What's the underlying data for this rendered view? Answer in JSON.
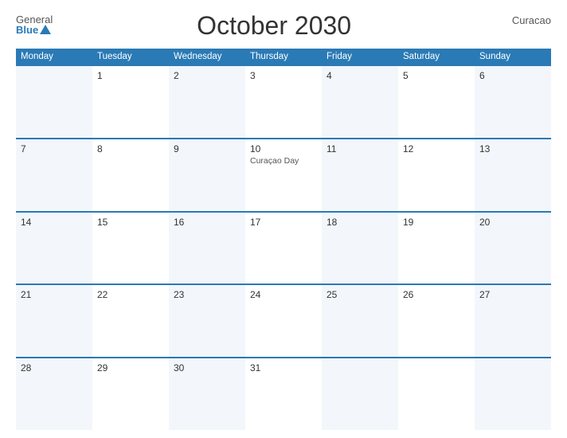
{
  "header": {
    "logo_general": "General",
    "logo_blue": "Blue",
    "title": "October 2030",
    "country": "Curacao"
  },
  "weekdays": [
    "Monday",
    "Tuesday",
    "Wednesday",
    "Thursday",
    "Friday",
    "Saturday",
    "Sunday"
  ],
  "weeks": [
    [
      {
        "num": "",
        "event": ""
      },
      {
        "num": "1",
        "event": ""
      },
      {
        "num": "2",
        "event": ""
      },
      {
        "num": "3",
        "event": ""
      },
      {
        "num": "4",
        "event": ""
      },
      {
        "num": "5",
        "event": ""
      },
      {
        "num": "6",
        "event": ""
      }
    ],
    [
      {
        "num": "7",
        "event": ""
      },
      {
        "num": "8",
        "event": ""
      },
      {
        "num": "9",
        "event": ""
      },
      {
        "num": "10",
        "event": "Curaçao Day"
      },
      {
        "num": "11",
        "event": ""
      },
      {
        "num": "12",
        "event": ""
      },
      {
        "num": "13",
        "event": ""
      }
    ],
    [
      {
        "num": "14",
        "event": ""
      },
      {
        "num": "15",
        "event": ""
      },
      {
        "num": "16",
        "event": ""
      },
      {
        "num": "17",
        "event": ""
      },
      {
        "num": "18",
        "event": ""
      },
      {
        "num": "19",
        "event": ""
      },
      {
        "num": "20",
        "event": ""
      }
    ],
    [
      {
        "num": "21",
        "event": ""
      },
      {
        "num": "22",
        "event": ""
      },
      {
        "num": "23",
        "event": ""
      },
      {
        "num": "24",
        "event": ""
      },
      {
        "num": "25",
        "event": ""
      },
      {
        "num": "26",
        "event": ""
      },
      {
        "num": "27",
        "event": ""
      }
    ],
    [
      {
        "num": "28",
        "event": ""
      },
      {
        "num": "29",
        "event": ""
      },
      {
        "num": "30",
        "event": ""
      },
      {
        "num": "31",
        "event": ""
      },
      {
        "num": "",
        "event": ""
      },
      {
        "num": "",
        "event": ""
      },
      {
        "num": "",
        "event": ""
      }
    ]
  ]
}
